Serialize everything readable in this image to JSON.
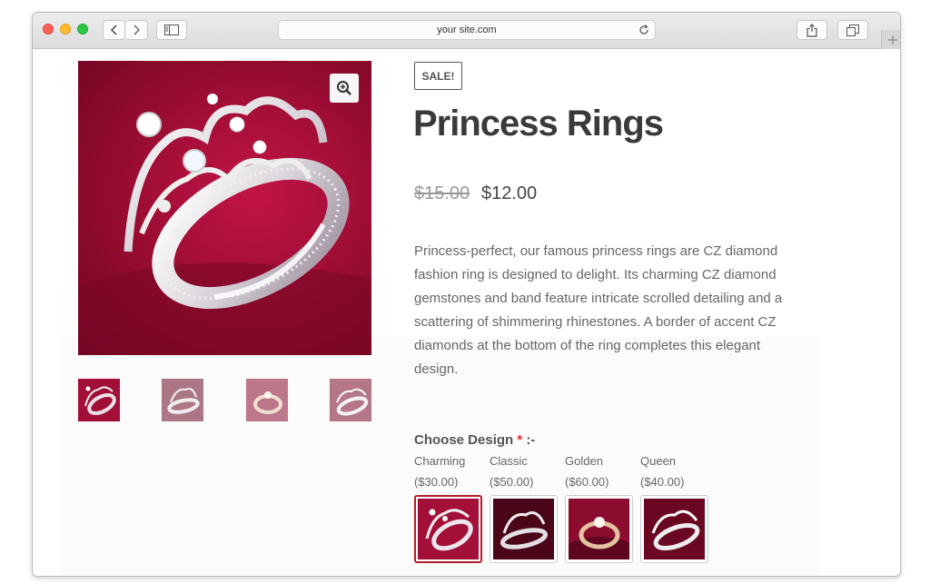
{
  "browser": {
    "address": "your site.com"
  },
  "product": {
    "badge": "SALE!",
    "title": "Princess Rings",
    "price_old": "$15.00",
    "price_new": "$12.00",
    "description": "Princess-perfect, our famous princess rings are CZ diamond fashion ring is designed to delight. Its charming CZ diamond gemstones and band feature intricate scrolled detailing and a scattering of shimmering rhinestones. A border of accent CZ diamonds at the bottom of the ring completes this elegant design."
  },
  "design": {
    "label": "Choose Design",
    "required_mark": "*",
    "suffix": " :-",
    "options": [
      {
        "name": "Charming",
        "price": "($30.00)"
      },
      {
        "name": "Classic",
        "price": "($50.00)"
      },
      {
        "name": "Golden",
        "price": "($60.00)"
      },
      {
        "name": "Queen",
        "price": "($40.00)"
      }
    ],
    "selected_index": 0
  },
  "colors": {
    "accent": "#b31b2a",
    "ring_background": "#9e0d34"
  },
  "icons": {
    "zoom": "zoom-in-icon",
    "back": "chevron-left-icon",
    "forward": "chevron-right-icon",
    "sidebar": "sidebar-icon",
    "reload": "reload-icon",
    "share": "share-icon",
    "tabs": "tabs-icon",
    "new_tab": "plus-icon"
  }
}
